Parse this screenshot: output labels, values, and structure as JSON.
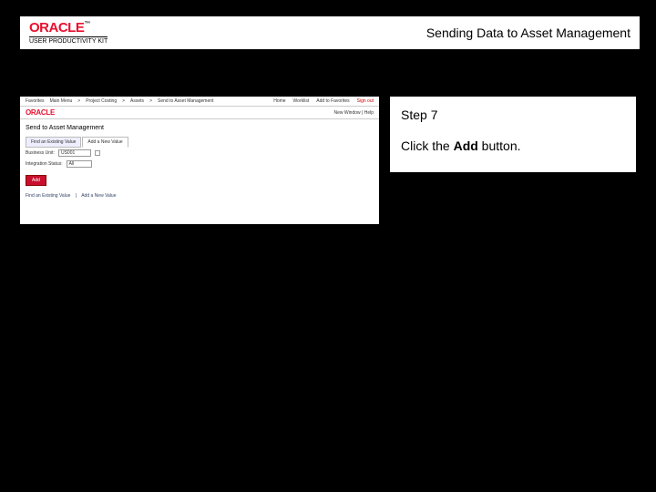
{
  "header": {
    "brand_logo": "ORACLE",
    "brand_tm": "™",
    "brand_sub": "USER PRODUCTIVITY KIT",
    "title": "Sending Data to Asset Management"
  },
  "instructions": {
    "step_label": "Step 7",
    "text_before": "Click the ",
    "bold": "Add",
    "text_after": " button."
  },
  "screenshot": {
    "nav": {
      "items": [
        "Favorites",
        "Main Menu",
        "Project Costing",
        "Assets",
        "Send to Asset Management"
      ],
      "right": {
        "home": "Home",
        "worklist": "Worklist",
        "addfav": "Add to Favorites",
        "signout": "Sign out"
      }
    },
    "brand": "ORACLE",
    "newwin": "New Window | Help",
    "page_title": "Send to Asset Management",
    "tabs": {
      "t1": "Find an Existing Value",
      "t2": "Add a New Value"
    },
    "field_bu": {
      "label": "Business Unit:",
      "value": "US001"
    },
    "field_integ": {
      "label": "Integration Status:",
      "value": "All"
    },
    "add_button": "Add",
    "links": {
      "l1": "Find an Existing Value",
      "sep": "|",
      "l2": "Add a New Value"
    }
  }
}
